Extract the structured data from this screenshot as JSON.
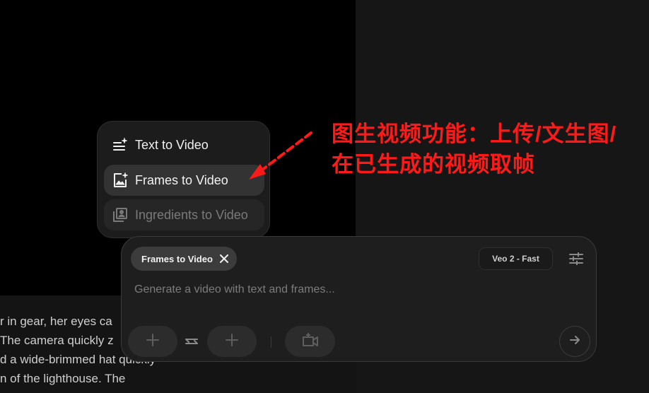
{
  "background_text": {
    "lines": [
      "r in gear, her eyes ca",
      " The camera quickly z",
      "d a wide-brimmed hat quickly",
      "n of the lighthouse. The"
    ]
  },
  "mode_menu": {
    "items": [
      {
        "label": "Text to Video",
        "icon": "text-sparkle-icon",
        "state": "normal"
      },
      {
        "label": "Frames to Video",
        "icon": "image-sparkle-icon",
        "state": "selected"
      },
      {
        "label": "Ingredients to Video",
        "icon": "ingredients-icon",
        "state": "disabled"
      }
    ]
  },
  "composer": {
    "mode_chip": {
      "label": "Frames to Video"
    },
    "model_selector": {
      "label": "Veo 2 - Fast"
    },
    "prompt": {
      "placeholder": "Generate a video with text and frames...",
      "value": ""
    },
    "icons": {
      "first_frame": "plus-icon",
      "swap": "swap-arrows-icon",
      "last_frame": "plus-icon",
      "camera": "camera-motion-icon",
      "settings": "sliders-icon",
      "send": "arrow-right-icon"
    }
  },
  "annotation": {
    "text": "图生视频功能：上传/文生图/在已生成的视频取帧",
    "color": "#ff1a1a"
  },
  "colors": {
    "accent_red": "#ff1a1a",
    "panel": "#1e1e1e",
    "chip": "#3c3c3c"
  }
}
